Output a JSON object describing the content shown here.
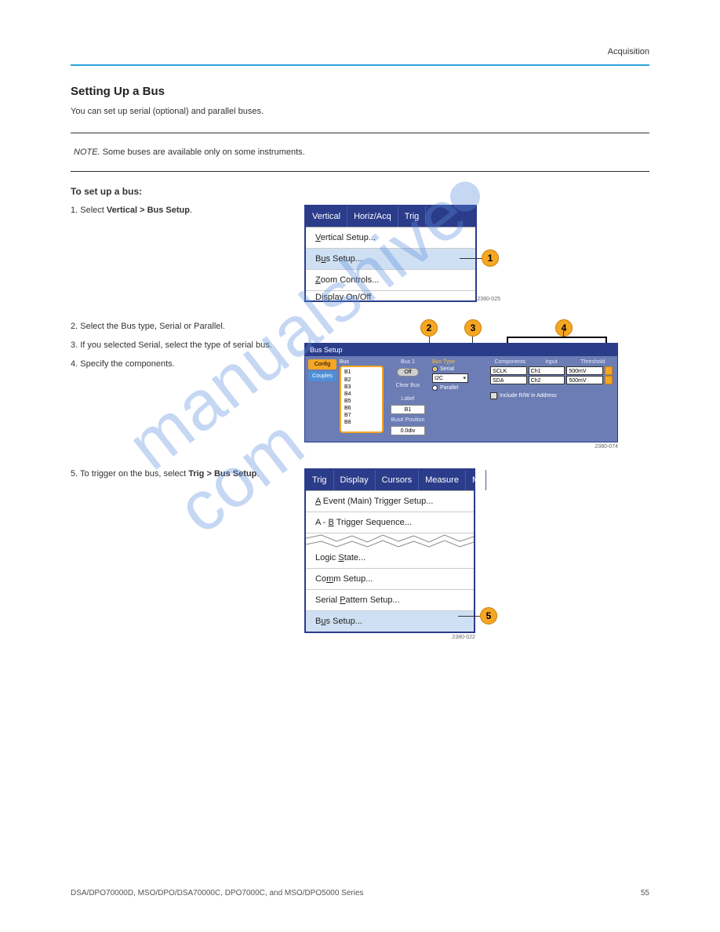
{
  "page": {
    "running_head": "Acquisition",
    "section_title": "Setting Up a Bus",
    "intro": "You can set up serial (optional) and parallel buses.",
    "note_label": "NOTE.",
    "note_text": "Some buses are available only on some instruments.",
    "setup_title": "To set up a bus:"
  },
  "watermark": "manualshive.com",
  "steps": {
    "s1": {
      "num": "1.",
      "text_a": "Select ",
      "bold": "Vertical > Bus Setup",
      "text_b": "."
    },
    "s2": {
      "num": "2.",
      "text": "Select the Bus type, Serial or Parallel."
    },
    "s3": {
      "num": "3.",
      "text": "If you selected Serial, select the type of serial bus."
    },
    "s4": {
      "num": "4.",
      "text": "Specify the components."
    },
    "s5": {
      "num": "5.",
      "text_a": "To trigger on the bus, select ",
      "bold": "Trig > Bus Setup",
      "text_b": "."
    }
  },
  "fig1": {
    "menubar": [
      "Vertical",
      "Horiz/Acq",
      "Trig"
    ],
    "items": [
      {
        "pre": "",
        "u": "V",
        "post": "ertical Setup..."
      },
      {
        "pre": "B",
        "u": "u",
        "post": "s Setup..."
      },
      {
        "pre": "",
        "u": "Z",
        "post": "oom Controls..."
      },
      {
        "pre": "Display On/Off",
        "u": "",
        "post": ""
      }
    ],
    "callout": "1",
    "fig_id": "2380-025"
  },
  "fig2": {
    "title": "Bus Setup",
    "tabs": {
      "active": "Config",
      "inactive": "Couples"
    },
    "bus_label": "Bus",
    "bus_items": [
      "B1",
      "B2",
      "B3",
      "B4",
      "B5",
      "B6",
      "B7",
      "B8"
    ],
    "bus1_label": "Bus 1",
    "off": "Off",
    "clear_bus": "Clear Bus",
    "label_label": "Label",
    "label_value": "B1",
    "buspos_label": "Bus# Position",
    "buspos_value": "0.0div",
    "bustype_label": "Bus Type",
    "radio_serial": "Serial",
    "radio_parallel": "Parallel",
    "select_value": "I2C",
    "comp_head": [
      "Components",
      "Input",
      "Threshold"
    ],
    "rows": [
      {
        "c": "SCLK",
        "i": "Ch1",
        "t": "500mV"
      },
      {
        "c": "SDA",
        "i": "Ch2",
        "t": "500mV"
      }
    ],
    "include": "Include R/W in Address",
    "callouts": {
      "c2": "2",
      "c3": "3",
      "c4": "4"
    },
    "fig_id": "2380-074"
  },
  "fig3": {
    "menubar": [
      "Trig",
      "Display",
      "Cursors",
      "Measure",
      "M"
    ],
    "items_top": [
      {
        "pre": "",
        "u": "A",
        "post": " Event (Main) Trigger Setup..."
      },
      {
        "pre": "A - ",
        "u": "B",
        "post": " Trigger Sequence..."
      }
    ],
    "items_bottom": [
      {
        "pre": "Logic ",
        "u": "S",
        "post": "tate..."
      },
      {
        "pre": "Co",
        "u": "m",
        "post": "m Setup..."
      },
      {
        "pre": "Serial ",
        "u": "P",
        "post": "attern Setup..."
      },
      {
        "pre": "B",
        "u": "u",
        "post": "s Setup..."
      }
    ],
    "callout": "5",
    "fig_id": "2380-022"
  },
  "footer": {
    "left": "DSA/DPO70000D, MSO/DPO/DSA70000C, DPO7000C, and MSO/DPO5000 Series",
    "right": "55"
  }
}
